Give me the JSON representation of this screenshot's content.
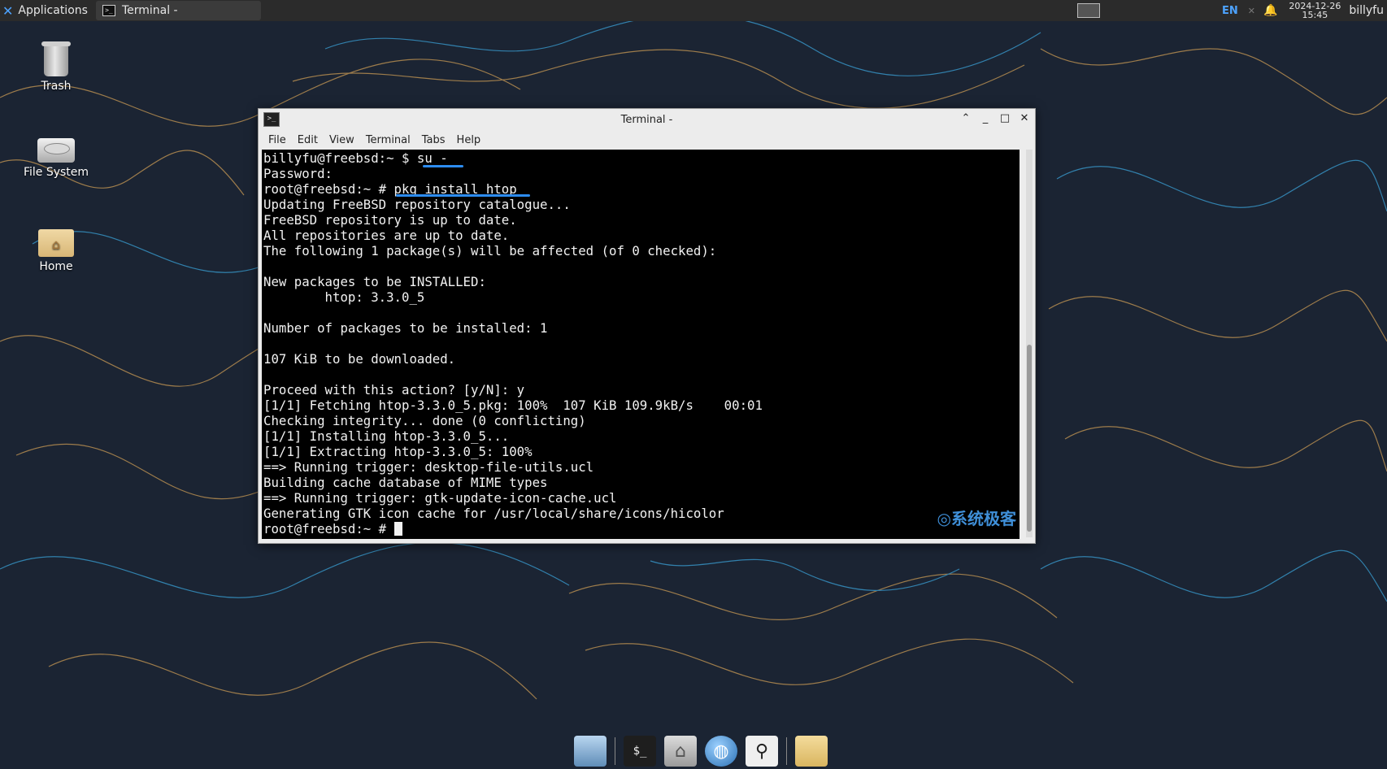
{
  "top_panel": {
    "applications_label": "Applications",
    "task_label": "Terminal -",
    "language": "EN",
    "clock_date": "2024-12-26",
    "clock_time": "15:45",
    "user": "billyfu"
  },
  "desktop_icons": {
    "trash": "Trash",
    "filesystem": "File System",
    "home": "Home"
  },
  "terminal": {
    "title": "Terminal -",
    "menu": [
      "File",
      "Edit",
      "View",
      "Terminal",
      "Tabs",
      "Help"
    ],
    "lines": [
      "billyfu@freebsd:~ $ su -",
      "Password:",
      "root@freebsd:~ # pkg install htop",
      "Updating FreeBSD repository catalogue...",
      "FreeBSD repository is up to date.",
      "All repositories are up to date.",
      "The following 1 package(s) will be affected (of 0 checked):",
      "",
      "New packages to be INSTALLED:",
      "        htop: 3.3.0_5",
      "",
      "Number of packages to be installed: 1",
      "",
      "107 KiB to be downloaded.",
      "",
      "Proceed with this action? [y/N]: y",
      "[1/1] Fetching htop-3.3.0_5.pkg: 100%  107 KiB 109.9kB/s    00:01",
      "Checking integrity... done (0 conflicting)",
      "[1/1] Installing htop-3.3.0_5...",
      "[1/1] Extracting htop-3.3.0_5: 100%",
      "==> Running trigger: desktop-file-utils.ucl",
      "Building cache database of MIME types",
      "==> Running trigger: gtk-update-icon-cache.ucl",
      "Generating GTK icon cache for /usr/local/share/icons/hicolor",
      "root@freebsd:~ # "
    ],
    "watermark": "系统极客"
  },
  "dock": {
    "items": [
      "desktop-icon",
      "terminal-icon",
      "home-folder-icon",
      "web-browser-icon",
      "search-icon",
      "file-manager-icon"
    ],
    "terminal_glyph": "$_"
  },
  "colors": {
    "accent": "#2d8cf0",
    "panel": "#2b2b2b",
    "terminal_bg": "#000000",
    "wallpaper": "#1b2433"
  }
}
